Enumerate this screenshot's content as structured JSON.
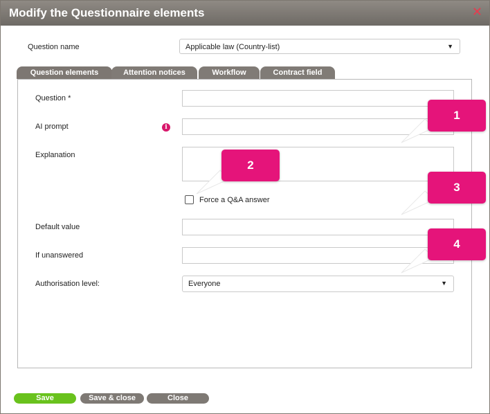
{
  "dialog": {
    "title": "Modify the Questionnaire elements",
    "close_glyph": "✕"
  },
  "question_name": {
    "label": "Question name",
    "value": "Applicable law (Country-list)"
  },
  "tabs": [
    {
      "label": "Question elements"
    },
    {
      "label": "Attention notices"
    },
    {
      "label": "Workflow"
    },
    {
      "label": "Contract field"
    }
  ],
  "form": {
    "question_label": "Question *",
    "question_value": "",
    "ai_prompt_label": "AI prompt",
    "ai_prompt_value": "",
    "info_glyph": "i",
    "explanation_label": "Explanation",
    "explanation_value": "",
    "force_qa_label": "Force a Q&A answer",
    "force_qa_checked": false,
    "default_value_label": "Default value",
    "default_value_value": "",
    "if_unanswered_label": "If unanswered",
    "if_unanswered_value": "",
    "authorisation_label": "Authorisation level:",
    "authorisation_value": "Everyone"
  },
  "callouts": [
    "1",
    "2",
    "3",
    "4"
  ],
  "buttons": {
    "save": "Save",
    "save_close": "Save & close",
    "close": "Close"
  },
  "colors": {
    "titlebar": "#7d7770",
    "accent_pink": "#e5147a",
    "save_green": "#69c21d",
    "gray_button": "#7e7974"
  },
  "icons": {
    "close": "close-icon",
    "info": "info-icon",
    "dropdown": "chevron-down-icon"
  }
}
